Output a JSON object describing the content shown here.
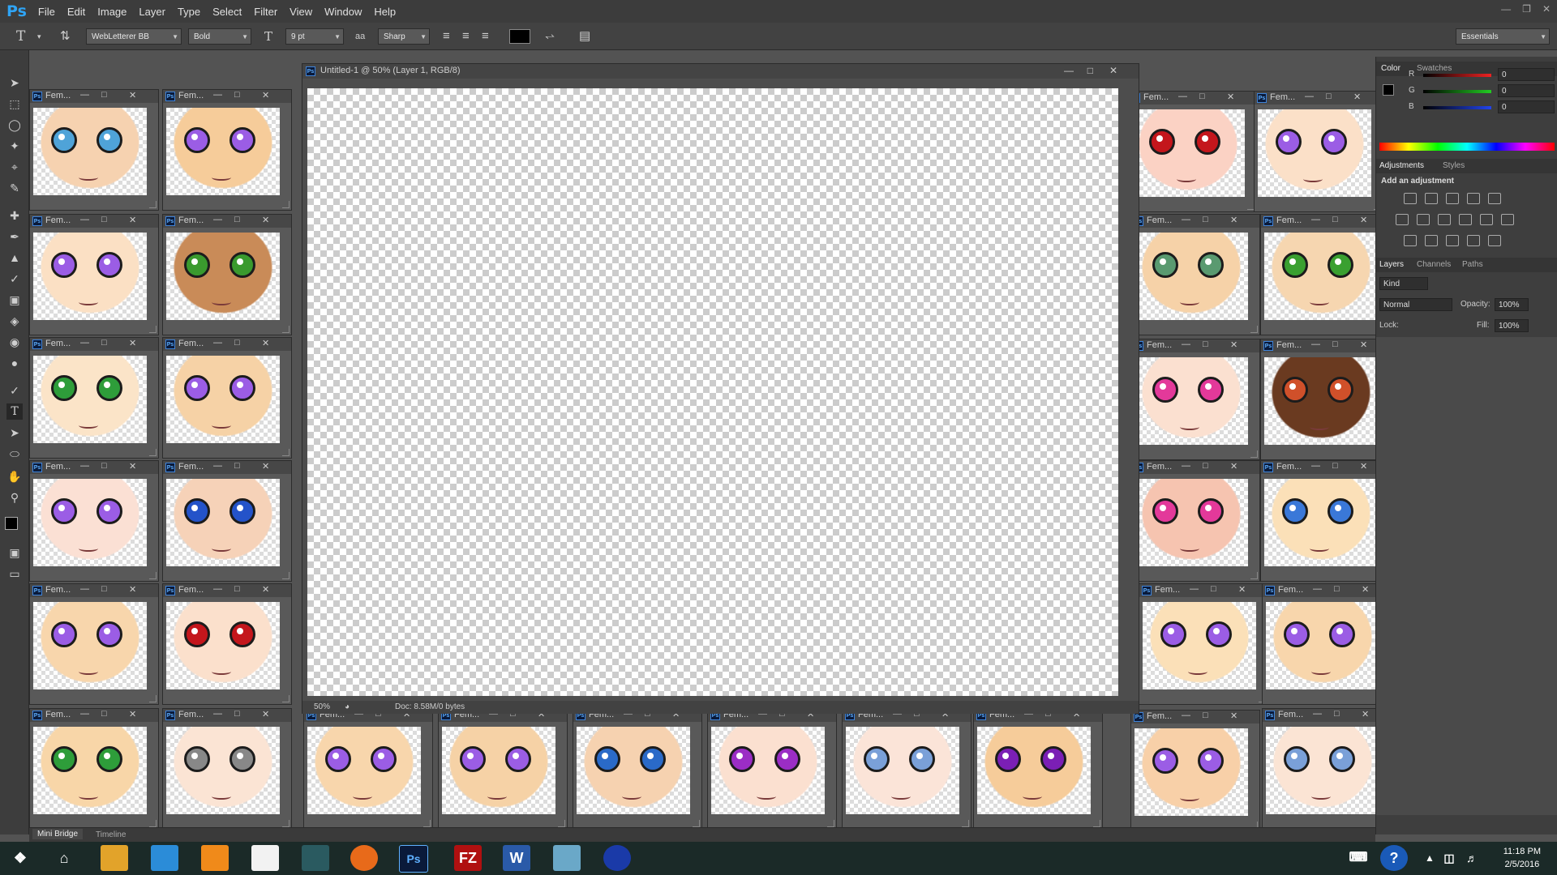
{
  "app": {
    "logo": "Ps"
  },
  "menu": [
    "File",
    "Edit",
    "Image",
    "Layer",
    "Type",
    "Select",
    "Filter",
    "View",
    "Window",
    "Help"
  ],
  "options": {
    "font_family": "WebLetterer BB",
    "font_style": "Bold",
    "font_size": "9 pt",
    "antialias_icon": "aa",
    "antialias": "Sharp",
    "workspace": "Essentials",
    "text_color": "#000000"
  },
  "document": {
    "title": "Untitled-1 @ 50% (Layer 1, RGB/8)",
    "zoom": "50%",
    "doc_info": "Doc: 8.58M/0 bytes"
  },
  "thumb_title": "Fem...",
  "thumbnails": [
    {
      "eye": "#4fa3d8",
      "skin": "#f6d2b0"
    },
    {
      "eye": "#9b5de5",
      "skin": "#f6cc9a"
    },
    {
      "eye": "#9b5de5",
      "skin": "#fbe0c4"
    },
    {
      "eye": "#3a9a2e",
      "skin": "#c98b58"
    },
    {
      "eye": "#2e9d3a",
      "skin": "#fbe4c8"
    },
    {
      "eye": "#9b5de5",
      "skin": "#f6d2a6"
    },
    {
      "eye": "#9b5de5",
      "skin": "#fbe0d4"
    },
    {
      "eye": "#2453c9",
      "skin": "#f6d2b8"
    },
    {
      "eye": "#9b5de5",
      "skin": "#f8d6ac"
    },
    {
      "eye": "#c4161c",
      "skin": "#fbe0cc"
    },
    {
      "eye": "#2e9d3a",
      "skin": "#f8d6a8"
    },
    {
      "eye": "#888888",
      "skin": "#fbe4d4"
    },
    {
      "eye": "#c4161c",
      "skin": "#fbd2c4"
    },
    {
      "eye": "#9b5de5",
      "skin": "#fbe0c8"
    },
    {
      "eye": "#5a9a70",
      "skin": "#f6d2a8"
    },
    {
      "eye": "#3aa030",
      "skin": "#f6d6b0"
    },
    {
      "eye": "#e3399a",
      "skin": "#fbe0d0"
    },
    {
      "eye": "#d0502a",
      "skin": "#6a3a20"
    },
    {
      "eye": "#e3399a",
      "skin": "#fbe0c8"
    },
    {
      "eye": "#e3399a",
      "skin": "#f6c4b0"
    },
    {
      "eye": "#3a78d8",
      "skin": "#fbe0b8"
    },
    {
      "eye": "#9b5de5",
      "skin": "#f8d6ac"
    },
    {
      "eye": "#9b5de5",
      "skin": "#fbe0b8"
    },
    {
      "eye": "#9b5de5",
      "skin": "#f8d6ac"
    },
    {
      "eye": "#5a9a70",
      "skin": "#a86a48"
    },
    {
      "eye": "#9b5de5",
      "skin": "#f8d0a8"
    },
    {
      "eye": "#7aa0d8",
      "skin": "#fbe4d4"
    },
    {
      "eye": "#e3399a",
      "skin": "#fbe0c4"
    },
    {
      "eye": "#9b5de5",
      "skin": "#f8d6ac"
    },
    {
      "eye": "#9b5de5",
      "skin": "#f6d2a6"
    },
    {
      "eye": "#2a6ac8",
      "skin": "#f6d2b0"
    },
    {
      "eye": "#9b2dc5",
      "skin": "#fbe0d0"
    },
    {
      "eye": "#7aa0d8",
      "skin": "#fbe4d8"
    },
    {
      "eye": "#7b1fb5",
      "skin": "#f6cc9a"
    }
  ],
  "panels": {
    "color_tab": "Color",
    "swatches_tab": "Swatches",
    "channels": [
      {
        "label": "R",
        "value": "0",
        "color": "#e22"
      },
      {
        "label": "G",
        "value": "0",
        "color": "#2c2"
      },
      {
        "label": "B",
        "value": "0",
        "color": "#24e"
      }
    ],
    "adjustments_tab": "Adjustments",
    "styles_tab": "Styles",
    "add_adjustment": "Add an adjustment",
    "layers_tab": "Layers",
    "channels_tab": "Channels",
    "paths_tab": "Paths",
    "kind": "Kind",
    "blend": "Normal",
    "opacity_label": "Opacity:",
    "opacity": "100%",
    "fill_label": "Fill:",
    "fill": "100%",
    "lock_label": "Lock:"
  },
  "bottom": {
    "mini_bridge": "Mini Bridge",
    "timeline": "Timeline"
  },
  "clock": {
    "time": "11:18 PM",
    "date": "2/5/2016"
  }
}
